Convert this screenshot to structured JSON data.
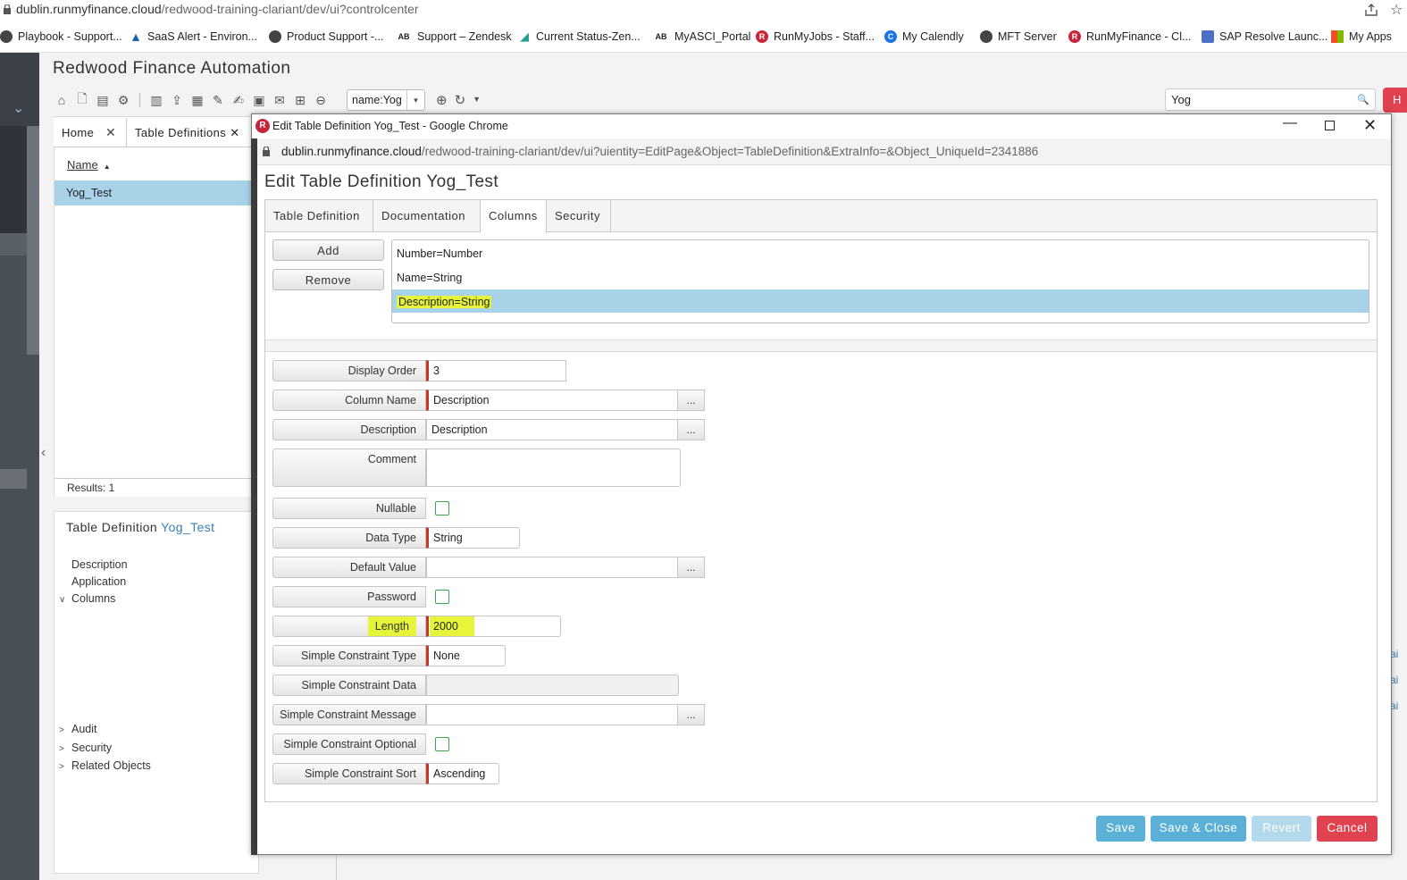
{
  "browser": {
    "url_host": "dublin.runmyfinance.cloud",
    "url_path": "/redwood-training-clariant/dev/ui?controlcenter"
  },
  "bookmarks": [
    {
      "label": "Playbook - Support...",
      "icon": "globe-icon",
      "color": "#444444"
    },
    {
      "label": "SaaS Alert - Environ...",
      "icon": "azure-icon",
      "color": "#1a5fb4"
    },
    {
      "label": "Product Support -...",
      "icon": "globe-icon",
      "color": "#444444"
    },
    {
      "label": "Support – Zendesk",
      "icon": "ab-icon",
      "color": "#222222"
    },
    {
      "label": "Current Status-Zen...",
      "icon": "chart-icon",
      "color": "#2a9d8f"
    },
    {
      "label": "MyASCI_Portal",
      "icon": "ab-icon",
      "color": "#222222"
    },
    {
      "label": "RunMyJobs - Staff...",
      "icon": "redwood-icon",
      "color": "#c8253a"
    },
    {
      "label": "My Calendly",
      "icon": "calendly-icon",
      "color": "#1a73e8"
    },
    {
      "label": "MFT Server",
      "icon": "globe-icon",
      "color": "#444444"
    },
    {
      "label": "RunMyFinance - Cl...",
      "icon": "redwood-icon",
      "color": "#c8253a"
    },
    {
      "label": "SAP Resolve Launc...",
      "icon": "sap-icon",
      "color": "#4a6fc4"
    },
    {
      "label": "My Apps",
      "icon": "microsoft-icon",
      "color": "#f25022"
    }
  ],
  "app": {
    "title": "Redwood Finance Automation",
    "name_filter": "name:Yog",
    "search_value": "Yog",
    "user_initial": "H",
    "tabs": [
      {
        "label": "Home"
      },
      {
        "label": "Table Definitions"
      }
    ],
    "list_header": "Name",
    "list_rows": [
      "Yog_Test"
    ],
    "results": "Results: 1",
    "detail_title_prefix": "Table Definition",
    "detail_title_name": "Yog_Test",
    "detail_tree": {
      "top": [
        "Description",
        "Application",
        "Columns"
      ],
      "bottom": [
        "Audit",
        "Security",
        "Related Objects"
      ]
    },
    "right_clip": [
      "ai",
      "ai",
      "ai"
    ]
  },
  "modal": {
    "window_title": "Edit Table Definition Yog_Test - Google Chrome",
    "url_host": "dublin.runmyfinance.cloud",
    "url_path": "/redwood-training-clariant/dev/ui?uientity=EditPage&Object=TableDefinition&ExtraInfo=&Object_UniqueId=2341886",
    "heading": "Edit Table Definition Yog_Test",
    "tabs": [
      "Table Definition",
      "Documentation",
      "Columns",
      "Security"
    ],
    "active_tab": "Columns",
    "add_label": "Add",
    "remove_label": "Remove",
    "columns": [
      "Number=Number",
      "Name=String",
      "Description=String"
    ],
    "selected_column": "Description=String",
    "fields": {
      "display_order": {
        "label": "Display Order",
        "value": "3"
      },
      "column_name": {
        "label": "Column Name",
        "value": "Description"
      },
      "description": {
        "label": "Description",
        "value": "Description"
      },
      "comment": {
        "label": "Comment",
        "value": ""
      },
      "nullable": {
        "label": "Nullable",
        "checked": false
      },
      "data_type": {
        "label": "Data Type",
        "value": "String"
      },
      "default_value": {
        "label": "Default Value",
        "value": ""
      },
      "password": {
        "label": "Password",
        "checked": false
      },
      "length": {
        "label": "Length",
        "value": "2000"
      },
      "simple_constraint_type": {
        "label": "Simple Constraint Type",
        "value": "None"
      },
      "simple_constraint_data": {
        "label": "Simple Constraint Data",
        "value": ""
      },
      "simple_constraint_message": {
        "label": "Simple Constraint Message",
        "value": ""
      },
      "simple_constraint_optional": {
        "label": "Simple Constraint Optional",
        "checked": false
      },
      "simple_constraint_sort": {
        "label": "Simple Constraint Sort",
        "value": "Ascending"
      }
    },
    "dots": "...",
    "actions": {
      "save": "Save",
      "save_close": "Save & Close",
      "revert": "Revert",
      "cancel": "Cancel"
    }
  },
  "colors": {
    "selection": "#a8d2e8",
    "highlight": "#e6f53a",
    "save": "#5bb0d8",
    "revert": "#b2d9ec",
    "cancel": "#e0424f",
    "required": "#c0392b"
  }
}
